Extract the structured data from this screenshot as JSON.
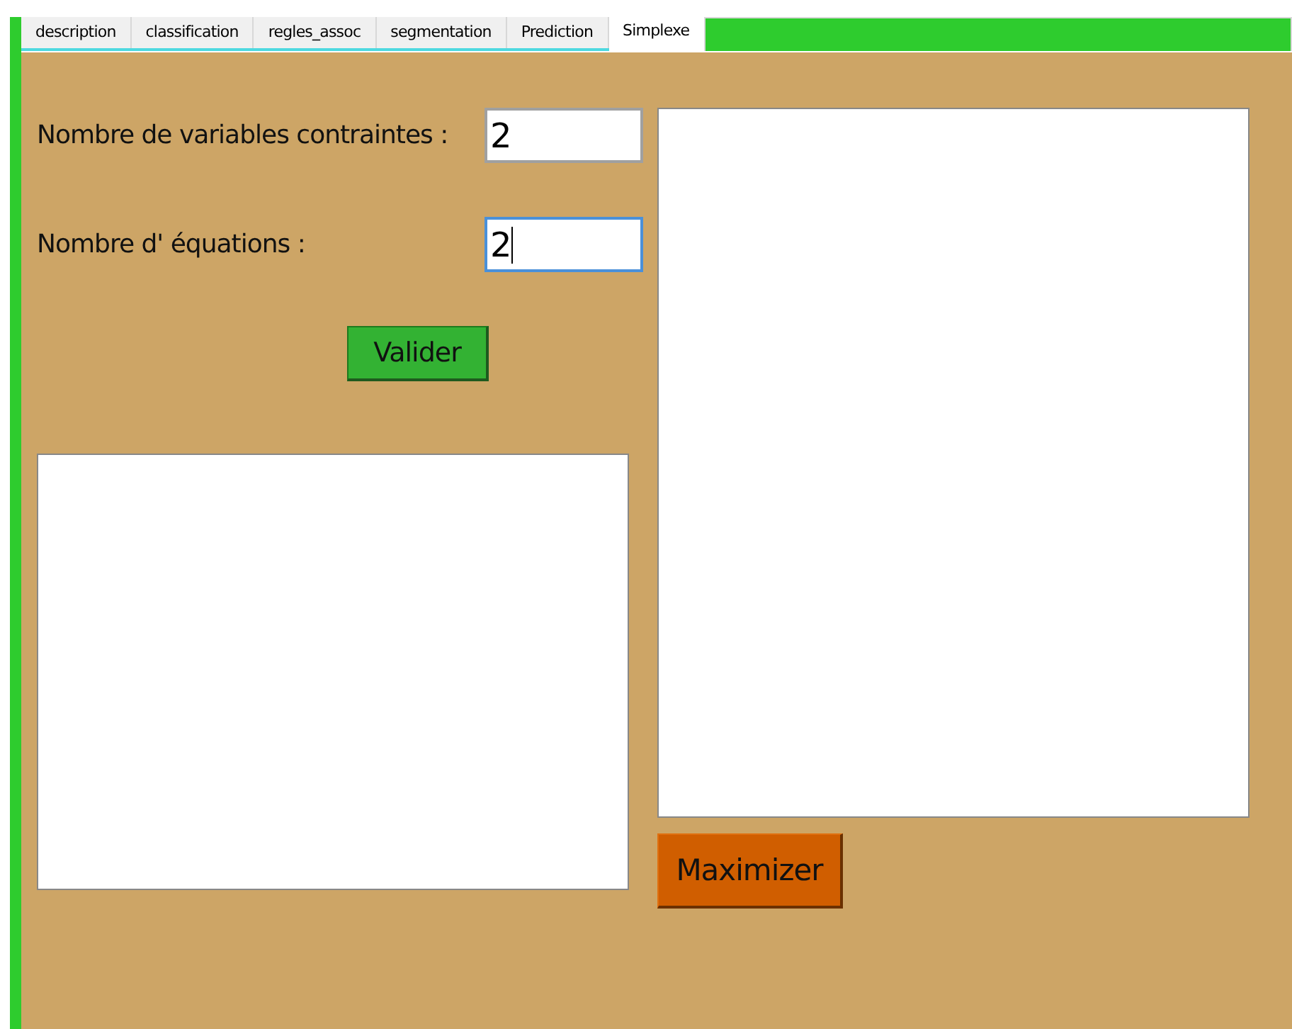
{
  "tabs": [
    {
      "label": "description",
      "selected": false
    },
    {
      "label": "classification",
      "selected": false
    },
    {
      "label": "regles_assoc",
      "selected": false
    },
    {
      "label": "segmentation",
      "selected": false
    },
    {
      "label": "Prediction",
      "selected": false
    },
    {
      "label": "Simplexe",
      "selected": true
    }
  ],
  "fields": [
    {
      "label": "Nombre de variables contraintes :",
      "value": "2",
      "focused": false
    },
    {
      "label": "Nombre d' équations :",
      "value": "2",
      "focused": true
    }
  ],
  "validate_button": "Valider",
  "maximize_button": "Maximizer"
}
